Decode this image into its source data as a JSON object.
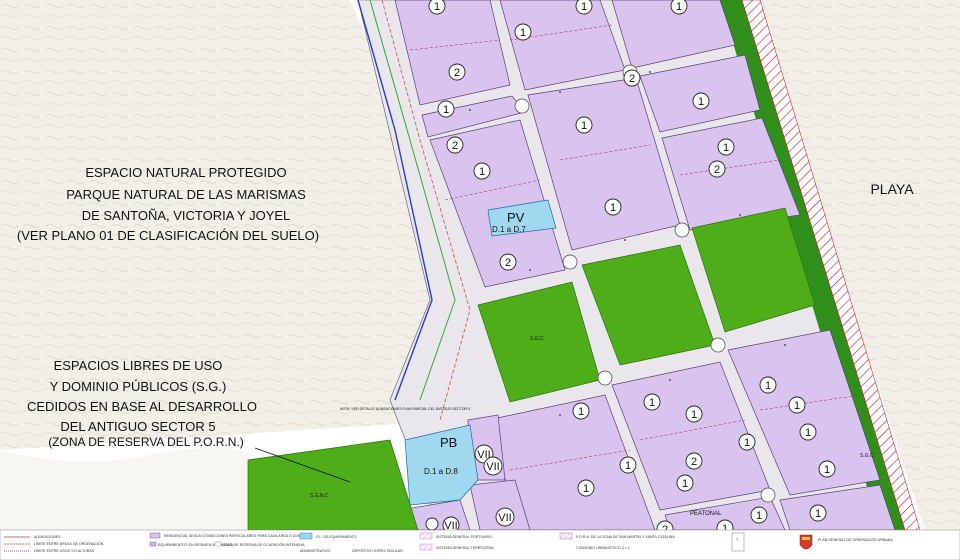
{
  "labels": {
    "natural_area": [
      "ESPACIO NATURAL PROTEGIDO",
      "PARQUE NATURAL DE LAS MARISMAS",
      "DE SANTOÑA, VICTORIA Y JOYEL",
      "(VER PLANO 01 DE CLASIFICACIÓN DEL SUELO)"
    ],
    "public_spaces": [
      "ESPACIOS LIBRES DE USO",
      "Y DOMINIO PÚBLICOS (S.G.)",
      "CEDIDOS EN BASE AL DESARROLLO",
      "DEL ANTIGUO SECTOR 5",
      "(ZONA DE RESERVA DEL P.O.R.N.)"
    ],
    "beach": "PLAYA",
    "pv_code": "PV",
    "pv_range": "D.1 a D.7",
    "pb_code": "PB",
    "pb_range": "D.1 a D.8",
    "zone_vii": "VII",
    "park_code": "S.G.C",
    "sgnc_code": "S.G.N.C",
    "street": "PEATONAL",
    "note": "NOTA: VER DETALLE ALINEACIONES PLAN PARCIAL DEL ANTIGUO SECTOR 5"
  },
  "zone_numbers": [
    "1",
    "1",
    "1",
    "2",
    "1",
    "1",
    "1",
    "2",
    "1",
    "2",
    "2",
    "1",
    "1",
    "2",
    "1",
    "1",
    "1",
    "1",
    "1",
    "1",
    "1",
    "1",
    "1",
    "2",
    "1",
    "1",
    "1",
    "1",
    "2",
    "1",
    "1"
  ],
  "legend": {
    "col1": [
      "ALINEACIONES",
      "LÍMITE ENTRE ÁREAS DE ORDENACIÓN",
      "LÍMITE ENTRE USOS Y/O ALTURAS"
    ],
    "col2": [
      "RESIDENCIAL SEGÚN CONDICIONES PARTICULARES PARA CADA ÁREA O ZONA",
      "EQUIPAMIENTOS EN RÉGIMEN INTENSIVO",
      "ZONA DE RESERVA DE OCUPACIÓN INTENSIVA"
    ],
    "col3": [
      "S.L. DE EQUIPAMIENTO",
      "ADMINISTRATIVO",
      "DEPORTIVO ESPECTACULAR"
    ],
    "col4": [
      "SISTEMA GENERAL PORTUARIO",
      "SISTEMA GENERAL TERRITORIAL"
    ],
    "col5": [
      "P.O.R.N. DE LA ZONA DE SAN MARTÍN Y SANTA CATALINA",
      "CONVENIO URBANÍSTICO C.I.1"
    ],
    "page": "1",
    "title": "PLAN GENERAL DE ORDENACIÓN URBANA"
  },
  "colors": {
    "residential": "#d9c4f0",
    "park": "#4fad1a",
    "equipment": "#9fd8ef",
    "dune": "#eeece4",
    "coastal_strip": "#2f8f1a"
  }
}
